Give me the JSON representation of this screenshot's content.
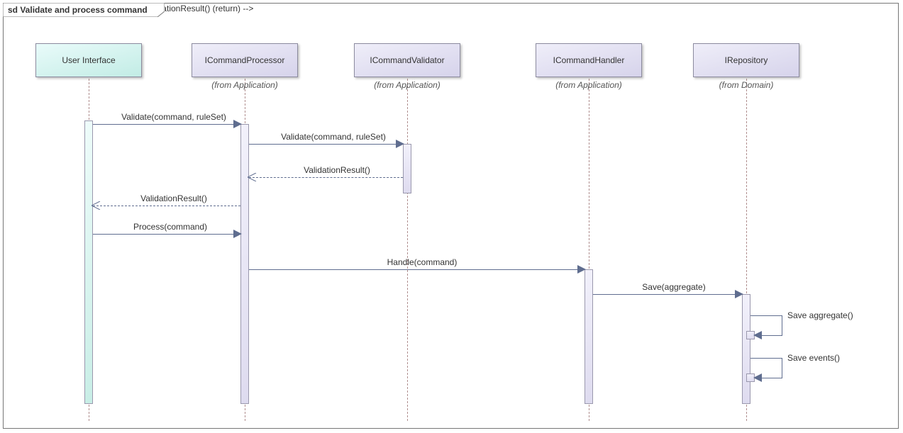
{
  "frame": {
    "title": "sd Validate and process command"
  },
  "lifelines": {
    "ui": {
      "name": "User Interface",
      "sub": ""
    },
    "proc": {
      "name": "ICommandProcessor",
      "sub": "(from Application)"
    },
    "valid": {
      "name": "ICommandValidator",
      "sub": "(from Application)"
    },
    "handler": {
      "name": "ICommandHandler",
      "sub": "(from Application)"
    },
    "repo": {
      "name": "IRepository",
      "sub": "(from Domain)"
    }
  },
  "messages": {
    "m1": "Validate(command, ruleSet)",
    "m2": "Validate(command, ruleSet)",
    "m3": "ValidationResult()",
    "m4": "ValidationResult()",
    "m5": "Process(command)",
    "m6": "Handle(command)",
    "m7": "Save(aggregate)",
    "m8": "Save aggregate()",
    "m9": "Save events()"
  }
}
